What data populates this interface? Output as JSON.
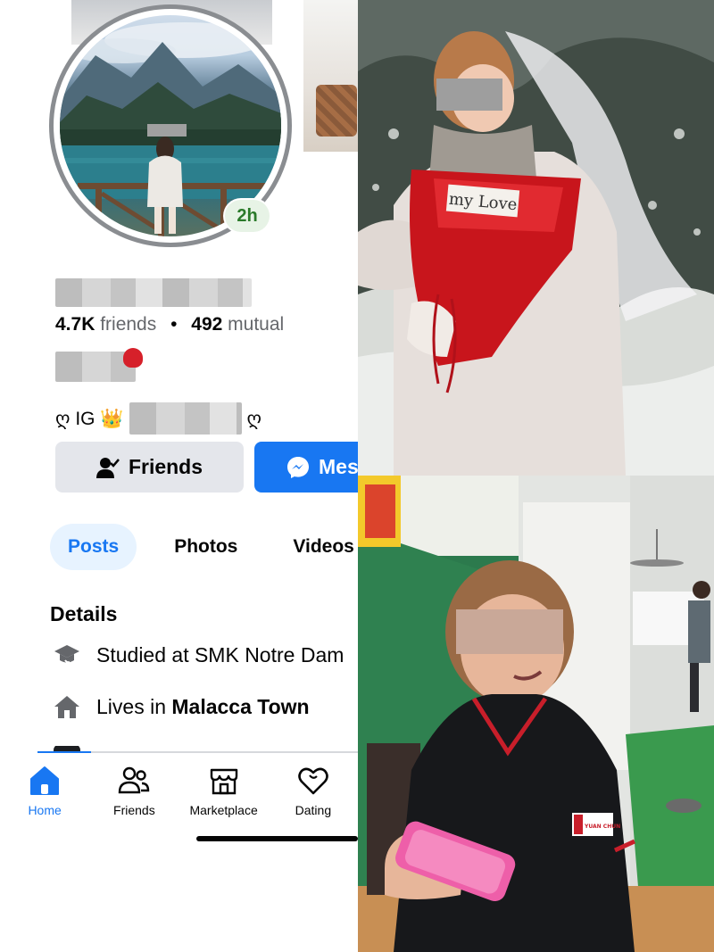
{
  "profile": {
    "story_badge": "2h",
    "friends_count": "4.7K",
    "friends_label": "friends",
    "separator": "•",
    "mutual_count": "492",
    "mutual_label": "mutual",
    "bio_prefix": "ღ IG 👑",
    "bio_suffix": "ღ"
  },
  "actions": {
    "friends_label": "Friends",
    "message_label": "Mes"
  },
  "tabs": [
    {
      "label": "Posts",
      "active": true
    },
    {
      "label": "Photos",
      "active": false
    },
    {
      "label": "Videos",
      "active": false
    }
  ],
  "details": {
    "title": "Details",
    "studied": "Studied at SMK Notre Dam",
    "lives_prefix": "Lives in ",
    "lives_place": "Malacca Town"
  },
  "bottom_nav": [
    {
      "label": "Home",
      "icon": "home-icon",
      "active": true
    },
    {
      "label": "Friends",
      "icon": "friends-icon",
      "active": false
    },
    {
      "label": "Marketplace",
      "icon": "marketplace-icon",
      "active": false
    },
    {
      "label": "Dating",
      "icon": "dating-icon",
      "active": false
    }
  ],
  "photo_texts": {
    "card_text": "my Love",
    "shirt_logo": "YUAN CHUN"
  },
  "colors": {
    "accent": "#1877f2",
    "tab_active_bg": "#e7f3ff",
    "button_gray": "#e4e6eb",
    "story_green": "#2a7a2a"
  }
}
